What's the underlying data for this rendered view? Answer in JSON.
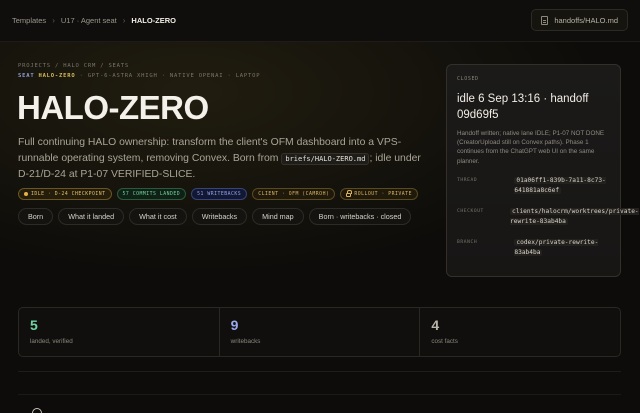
{
  "breadcrumb": {
    "items": [
      "Templates",
      "U17 · Agent seat",
      "HALO-ZERO"
    ]
  },
  "file_chip": {
    "label": "handoffs/HALO.md",
    "icon": "document-icon"
  },
  "eyebrow": "PROJECTS / HALO CRM / SEATS",
  "meta": {
    "seat": "SEAT",
    "name": "HALO-ZERO",
    "rest": "· GPT-6-ASTRA XHIGH · NATIVE OPENAI · LAPTOP"
  },
  "title": "HALO-ZERO",
  "description": {
    "before": "Full continuing HALO ownership: transform the client's OFM dashboard into a VPS-runnable operating system, removing Convex. Born from ",
    "code": "briefs/HALO-ZERO.md",
    "after": "; idle under D-21/D-24 at P1-07 VERIFIED-SLICE."
  },
  "badges": [
    "IDLE · D-24 CHECKPOINT",
    "57 COMMITS LANDED",
    "51 WRITEBACKS",
    "CLIENT · OFM (CAMROH)",
    "ROLLOUT · PRIVATE"
  ],
  "pills": [
    "Born",
    "What it landed",
    "What it cost",
    "Writebacks",
    "Mind map",
    "Born · writebacks · closed"
  ],
  "card": {
    "status": "CLOSED",
    "headline": "idle 6 Sep 13:16 · handoff 09d69f5",
    "body": "Handoff written; native lane IDLE; P1-07 NOT DONE (CreatorUpload still on Convex paths). Phase 1 continues from the ChatGPT web UI on the same planner.",
    "rows": [
      {
        "key": "THREAD",
        "value": "01a06ff1-839b-7a11-8c73-641881a8c6ef"
      },
      {
        "key": "CHECKOUT",
        "value": "clients/halocrm/worktrees/private-rewrite-83ab4ba"
      },
      {
        "key": "BRANCH",
        "value": "codex/private-rewrite-83ab4ba"
      }
    ]
  },
  "stats": [
    {
      "value": "5",
      "label": "landed, verified",
      "color": "#6fd3a4"
    },
    {
      "value": "9",
      "label": "writebacks",
      "color": "#9aa8ee"
    },
    {
      "value": "4",
      "label": "cost facts",
      "color": "#b9b4aa"
    }
  ]
}
